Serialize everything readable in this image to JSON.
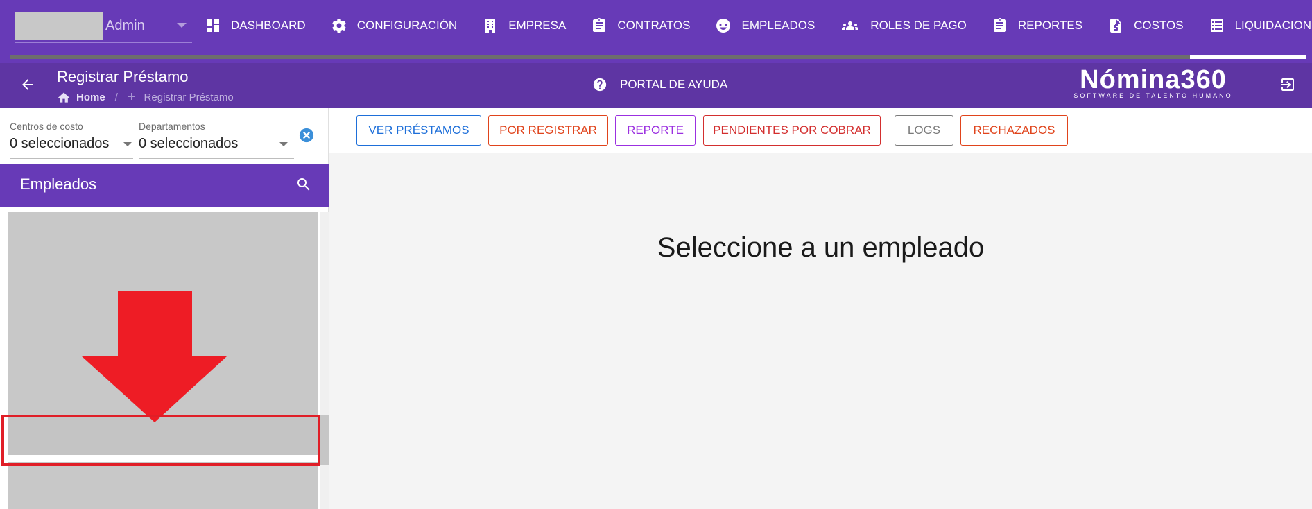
{
  "user": {
    "name": "Admin"
  },
  "nav": {
    "items": [
      {
        "label": "DASHBOARD",
        "icon": "dashboard-icon"
      },
      {
        "label": "CONFIGURACIÓN",
        "icon": "gear-icon"
      },
      {
        "label": "EMPRESA",
        "icon": "building-icon"
      },
      {
        "label": "CONTRATOS",
        "icon": "clipboard-icon"
      },
      {
        "label": "EMPLEADOS",
        "icon": "face-icon"
      },
      {
        "label": "ROLES DE PAGO",
        "icon": "group-icon"
      },
      {
        "label": "REPORTES",
        "icon": "clipboard-icon"
      },
      {
        "label": "COSTOS",
        "icon": "invoice-icon"
      },
      {
        "label": "LIQUIDACIONES",
        "icon": "list-icon"
      }
    ],
    "scroll_position_fraction": 0.91
  },
  "header": {
    "title": "Registrar Préstamo",
    "breadcrumb": {
      "home": "Home",
      "current": "Registrar Préstamo"
    },
    "help_label": "PORTAL DE AYUDA",
    "brand_name": "Nómina360",
    "brand_tagline": "SOFTWARE DE TALENTO HUMANO"
  },
  "filters": {
    "cost_centers": {
      "label": "Centros de costo",
      "value": "0 seleccionados"
    },
    "departments": {
      "label": "Departamentos",
      "value": "0 seleccionados"
    }
  },
  "employees": {
    "title": "Empleados"
  },
  "toolbar": {
    "buttons": [
      {
        "label": "VER PRÉSTAMOS",
        "color": "#1e6fd9"
      },
      {
        "label": "POR REGISTRAR",
        "color": "#e0441c"
      },
      {
        "label": "REPORTE",
        "color": "#9b30e0"
      },
      {
        "label": "PENDIENTES POR COBRAR",
        "color": "#d32f2f"
      },
      {
        "label": "LOGS",
        "color": "#7a7a7a"
      },
      {
        "label": "RECHAZADOS",
        "color": "#e0441c"
      }
    ]
  },
  "main": {
    "empty_message": "Seleccione a un empleado"
  },
  "colors": {
    "primary": "#673ab7",
    "primary_dark": "#5e35a3",
    "annotation": "#ee1c25"
  }
}
